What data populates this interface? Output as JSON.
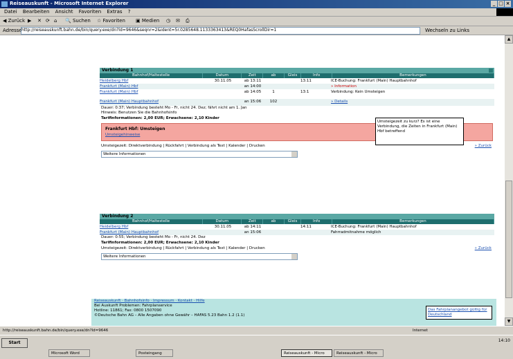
{
  "window": {
    "title": "Reiseauskunft - Microsoft Internet Explorer"
  },
  "menu": [
    "Datei",
    "Bearbeiten",
    "Ansicht",
    "Favoriten",
    "Extras",
    "?"
  ],
  "toolbar": {
    "back": "Zurück",
    "search": "Suchen",
    "favorites": "Favoriten",
    "media": "Medien"
  },
  "address": {
    "label": "Adresse",
    "url": "http://reiseauskunft.bahn.de/bin/query.exe/dn?ld=9646&seqnr=2&ident=5r.0285648.1133363413&REQ0HafasScrollDir=1",
    "go": "Wechseln zu",
    "links": "Links"
  },
  "panels": [
    {
      "header": "Verbindung 1",
      "columns": [
        "Bahnhof/Haltestelle",
        "Datum",
        "Zeit",
        "ab",
        "Gleis",
        "Info",
        "Bemerkungen"
      ],
      "rows": [
        {
          "station": "Heidelberg Hbf",
          "date": "30.11.05",
          "time": "ab 13:11",
          "track": "",
          "info": "13:11",
          "notes": "ICE-Buchung: Frankfurt (Main) Hauptbahnhof"
        },
        {
          "station": "Frankfurt (Main) Hbf",
          "date": "",
          "time": "an 14:00",
          "track": "",
          "info": "",
          "notes": "» Information"
        },
        {
          "station": "Frankfurt (Main) Hbf",
          "date": "",
          "time": "ab 14:05",
          "track": "1",
          "info": "13:1",
          "notes": "Verbindung: Kein Umsteigen"
        },
        {
          "station": "Frankfurt (Main) Hauptbahnhof",
          "date": "",
          "time": "an 15:06",
          "track": "102",
          "info": "",
          "notes": "» Details"
        }
      ],
      "note1": "Dauer: 0:37; Verbindung besteht Mo - Fr, nicht 24. Dez; fährt nicht am 1. Jan",
      "note2": "Hinweis: Benutzen Sie die Bahnhofsinfo",
      "tariff": "Tarifinformationen: 2,00 EUR; Erwachsene: 2,10 Kinder",
      "alert_title": "Frankfurt Hbf: Umsteigen",
      "alert_link": "Umsteigehinweise",
      "options": "Umsteigezeit: Direktverbindung | Rückfahrt | Verbindung als Text | Kalender | Drucken",
      "options_right": "» Zurück",
      "select": "Weitere Informationen"
    },
    {
      "header": "Verbindung 2",
      "columns": [
        "Bahnhof/Haltestelle",
        "Datum",
        "Zeit",
        "ab",
        "Gleis",
        "Info",
        "Bemerkungen"
      ],
      "rows": [
        {
          "station": "Heidelberg Hbf",
          "date": "30.11.05",
          "time": "ab 14:11",
          "track": "",
          "info": "14:11",
          "notes": "ICE-Buchung: Frankfurt (Main) Hauptbahnhof"
        },
        {
          "station": "Frankfurt (Main) Hauptbahnhof",
          "date": "",
          "time": "an 15:06",
          "track": "",
          "info": "",
          "notes": "Fahrradmitnahme möglich"
        }
      ],
      "note1": "Dauer: 0:55; Verbindung besteht Mo - Fr, nicht 24. Dez",
      "tariff": "Tarifinformationen: 2,00 EUR; Erwachsene: 2,10 Kinder",
      "options": "Umsteigezeit: Direktverbindung | Rückfahrt | Verbindung als Text | Kalender | Drucken",
      "options_right": "» Zurück",
      "select": "Weitere Informationen"
    }
  ],
  "tooltip": "Umsteigezeit zu kurz? Es ist eine Verbindung, die Zeiten in Frankfurt (Main) Hbf betreffend",
  "footer": {
    "line1": "Reiseauskunft · Bahnhofsinfo · Impressum · Kontakt · Hilfe",
    "line2": "Bei Auskunft Problemen: Fahrplanservice",
    "line3": "Hotline: 11861; Fax: 0800 1507090",
    "line4": "©Deutsche Bahn AG – Alle Angaben ohne Gewähr – HAFAS 5.23 Bahn 1.2 (1.1)",
    "box": "Das Fahrplanangebot gültig für Deutschland"
  },
  "status": "http://reiseauskunft.bahn.de/bin/query.exe/dn?ld=9646",
  "status_zone": "Internet",
  "taskbar": {
    "start": "Start",
    "tasks": [
      "Microsoft Word",
      "Posteingang",
      "Reiseauskunft - Micro",
      "Reiseauskunft - Micro"
    ],
    "clock": "14:10"
  }
}
